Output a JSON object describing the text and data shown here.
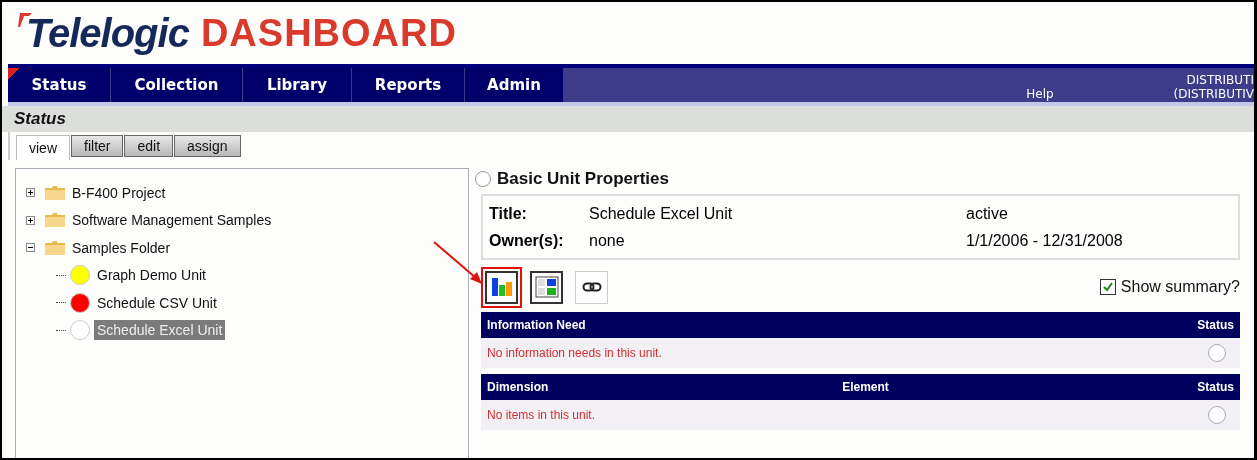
{
  "header": {
    "brand": "Telelogic",
    "product": "DASHBOARD"
  },
  "nav": {
    "items": [
      {
        "label": "Status",
        "selected": true
      },
      {
        "label": "Collection",
        "selected": false
      },
      {
        "label": "Library",
        "selected": false
      },
      {
        "label": "Reports",
        "selected": false
      },
      {
        "label": "Admin",
        "selected": false
      }
    ],
    "help": "Help",
    "user_lines": [
      "DISTRIBUTI",
      "(DISTRIBUTIV"
    ]
  },
  "page_title": "Status",
  "subtabs": [
    {
      "label": "view",
      "selected": true
    },
    {
      "label": "filter",
      "selected": false
    },
    {
      "label": "edit",
      "selected": false
    },
    {
      "label": "assign",
      "selected": false
    }
  ],
  "tree": [
    {
      "kind": "folder",
      "label": "B-F400 Project",
      "expanded": false,
      "selected": false
    },
    {
      "kind": "folder",
      "label": "Software Management Samples",
      "expanded": false,
      "selected": false
    },
    {
      "kind": "folder",
      "label": "Samples Folder",
      "expanded": true,
      "selected": false,
      "children": [
        {
          "kind": "unit",
          "label": "Graph Demo Unit",
          "color": "#ffff00",
          "selected": false
        },
        {
          "kind": "unit",
          "label": "Schedule CSV Unit",
          "color": "#ff0000",
          "selected": false
        },
        {
          "kind": "unit",
          "label": "Schedule Excel Unit",
          "color": "#ffffff",
          "selected": true
        }
      ]
    }
  ],
  "properties": {
    "heading": "Basic Unit Properties",
    "rows": [
      {
        "label": "Title:",
        "value": "Schedule Excel Unit",
        "extra": "active"
      },
      {
        "label": "Owner(s):",
        "value": "none",
        "extra": "1/1/2006 - 12/31/2008"
      }
    ]
  },
  "toolbar": [
    {
      "kind": "chart",
      "highlighted": true
    },
    {
      "kind": "grid",
      "highlighted": false
    },
    {
      "kind": "link",
      "highlighted": false
    }
  ],
  "show_summary": {
    "label": "Show summary?",
    "checked": true
  },
  "tables": [
    {
      "columns": [
        "Information Need",
        "Status"
      ],
      "empty": "No information needs in this unit."
    },
    {
      "columns": [
        "Dimension",
        "Element",
        "Status"
      ],
      "empty": "No items in this unit."
    }
  ]
}
